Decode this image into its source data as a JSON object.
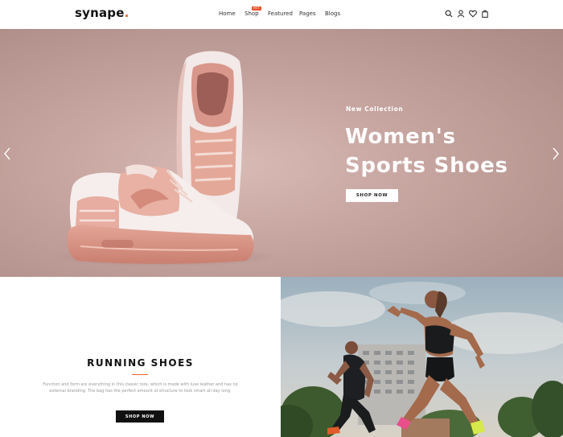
{
  "header": {
    "logo": "synape",
    "logo_dot": ".",
    "nav": [
      {
        "label": "Home"
      },
      {
        "label": "Shop"
      },
      {
        "label": "Featured"
      },
      {
        "label": "Pages"
      },
      {
        "label": "Blogs"
      }
    ],
    "shop_badge": "HOT",
    "icons": [
      "search-icon",
      "user-icon",
      "heart-icon",
      "bag-icon"
    ]
  },
  "hero": {
    "subtitle": "New Collection",
    "title": "Women's Sports Shoes",
    "button": "SHOP NOW",
    "colors": {
      "background": "#c4a29d",
      "text": "#ffffff"
    }
  },
  "promo": {
    "title": "RUNNING SHOES",
    "text": "Function and form are everything in this classic tote, which is made with luxe leather and has no external branding. The bag has the perfect amount of structure to look smart all day long.",
    "button": "SHOP NOW",
    "accent": "#e8652a"
  }
}
